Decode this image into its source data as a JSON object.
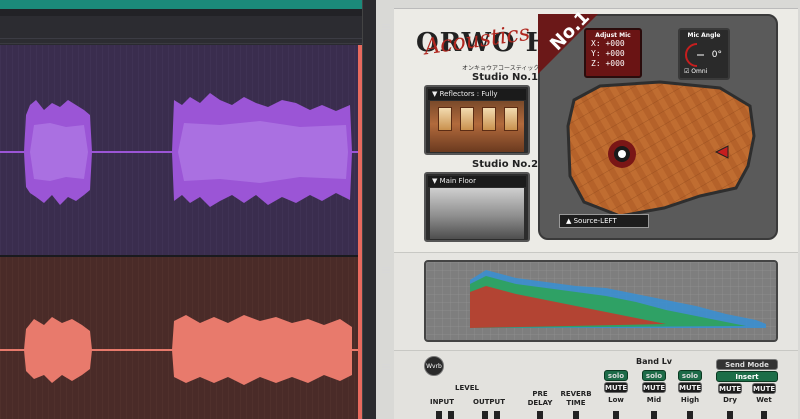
{
  "plugin": {
    "logo_text": "ORWO HAUS",
    "logo_script": "Acoustics",
    "logo_sub": "オンキョウアコースティック",
    "studio1": {
      "label": "Studio No.1",
      "select": "Reflectors : Fully"
    },
    "studio2": {
      "label": "Studio No.2",
      "select": "Main Floor"
    },
    "badge": "No.1",
    "adjust_mic": {
      "title": "Adjust Mic",
      "x": "X: +000",
      "y": "Y: +000",
      "z": "Z: +000"
    },
    "mic_angle": {
      "title": "Mic Angle",
      "value": "0°",
      "omni": "Omni",
      "omni_checked": true
    },
    "source_select": "Source-LEFT",
    "band_lv": "Band Lv",
    "solo_label": "solo",
    "mute_label": "MUTE",
    "send_mode": "Send Mode",
    "insert": "Insert",
    "level": "LEVEL",
    "knobs": {
      "input": "INPUT",
      "output": "OUTPUT",
      "pre_delay": "PRE\nDELAY",
      "reverb_time": "REVERB\nTIME",
      "low": "Low",
      "mid": "Mid",
      "high": "High",
      "dry": "Dry",
      "wet": "Wet"
    },
    "wverb_logo": "Wvrb"
  },
  "colors": {
    "track_purple": "#9b55d6",
    "track_red": "#e87a6c",
    "playhead": "#e86a5e",
    "solo_green": "#1d6b48"
  }
}
